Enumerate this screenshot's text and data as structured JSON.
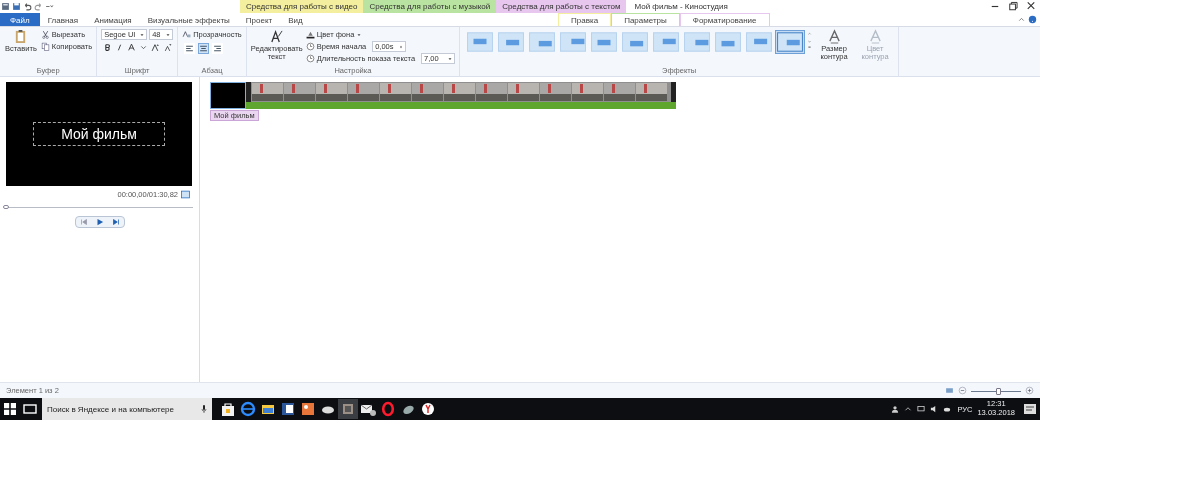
{
  "window": {
    "title": "Мой фильм - Киностудия"
  },
  "context_groups": [
    {
      "label": "Средства для работы с видео",
      "color": "#f3ef9e"
    },
    {
      "label": "Средства для работы с музыкой",
      "color": "#b9e3a0"
    },
    {
      "label": "Средства для работы с текстом",
      "color": "#e7c7ee"
    }
  ],
  "tabs": [
    {
      "label": "Файл",
      "kind": "file",
      "selected": false
    },
    {
      "label": "Главная",
      "kind": "main",
      "selected": false
    },
    {
      "label": "Анимация",
      "kind": "main",
      "selected": false
    },
    {
      "label": "Визуальные эффекты",
      "kind": "main",
      "selected": false
    },
    {
      "label": "Проект",
      "kind": "main",
      "selected": false
    },
    {
      "label": "Вид",
      "kind": "main",
      "selected": false
    },
    {
      "label": "Правка",
      "kind": "context",
      "selected": false
    },
    {
      "label": "Параметры",
      "kind": "context",
      "selected": false
    },
    {
      "label": "Форматирование",
      "kind": "context",
      "selected": true
    }
  ],
  "ribbon": {
    "clipboard": {
      "paste": "Вставить",
      "cut": "Вырезать",
      "copy": "Копировать",
      "group": "Буфер"
    },
    "font": {
      "family": "Segoe UI",
      "size": "48",
      "group": "Шрифт"
    },
    "paragraph": {
      "transparency": "Прозрачность",
      "align": [
        {
          "selected": false
        },
        {
          "selected": true
        },
        {
          "selected": false
        }
      ],
      "group": "Абзац"
    },
    "settings": {
      "edit_text": "Редактировать текст",
      "background": "Цвет фона",
      "start_label": "Время начала",
      "start_value": "0,00s",
      "duration_label": "Длительность показа текста",
      "duration_value": "7,00",
      "group": "Настройка"
    },
    "effects": {
      "items": [
        {
          "selected": false
        },
        {
          "selected": false
        },
        {
          "selected": false
        },
        {
          "selected": false
        },
        {
          "selected": false
        },
        {
          "selected": false
        },
        {
          "selected": false
        },
        {
          "selected": false
        },
        {
          "selected": false
        },
        {
          "selected": false
        },
        {
          "selected": true
        }
      ],
      "outline_size": "Размер контура",
      "outline_color": "Цвет контура",
      "outline_color_disabled": true,
      "group": "Эффекты"
    }
  },
  "preview": {
    "caption": "Мой фильм",
    "time": "00:00,00/01:30,82",
    "seek": {
      "level": 0.0
    }
  },
  "timeline": {
    "caption": "Мой фильм"
  },
  "status_bar": {
    "text": "Элемент 1 из 2",
    "zoom": {
      "level": 0.55
    }
  },
  "taskbar": {
    "search": {
      "placeholder": "Поиск в Яндексе и на компьютере"
    },
    "language": "РУС",
    "time": "12:31",
    "date": "13.03.2018"
  }
}
